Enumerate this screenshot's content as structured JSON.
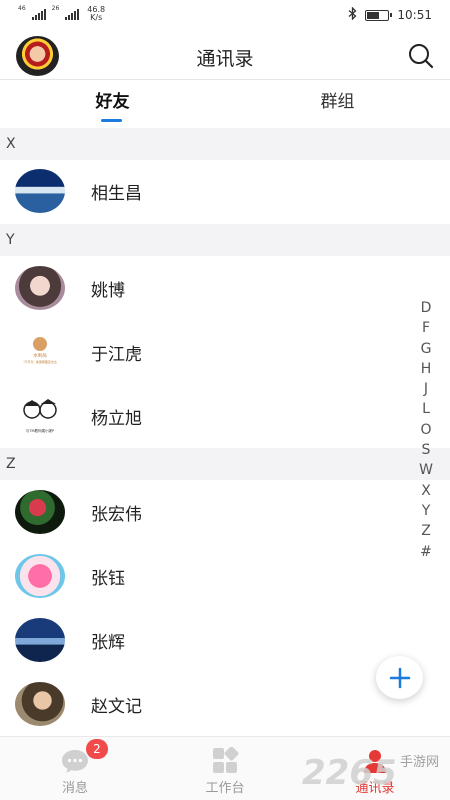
{
  "status_bar": {
    "sim1_label": "46",
    "sim2_label": "26",
    "speed_value": "46.8",
    "speed_unit": "K/s",
    "time": "10:51"
  },
  "header": {
    "title": "通讯录",
    "search_icon": "search-icon"
  },
  "tabs": [
    {
      "label": "好友",
      "active": true
    },
    {
      "label": "群组",
      "active": false
    }
  ],
  "sections": [
    {
      "letter": "X",
      "contacts": [
        {
          "name": "相生昌"
        }
      ]
    },
    {
      "letter": "Y",
      "contacts": [
        {
          "name": "姚博"
        },
        {
          "name": "于江虎"
        },
        {
          "name": "杨立旭"
        }
      ]
    },
    {
      "letter": "Z",
      "contacts": [
        {
          "name": "张宏伟"
        },
        {
          "name": "张钰"
        },
        {
          "name": "张辉"
        },
        {
          "name": "赵文记"
        }
      ]
    }
  ],
  "avatar_texts": {
    "logo_line1": "水利局",
    "logo_line2": "\"不平凡\" 奥里斯图克杰达",
    "comic_caption": "与TM着你嫂小妮P"
  },
  "index_letters": [
    "D",
    "F",
    "G",
    "H",
    "J",
    "L",
    "O",
    "S",
    "W",
    "X",
    "Y",
    "Z",
    "#"
  ],
  "fab": {
    "icon": "plus-icon"
  },
  "bottom_nav": [
    {
      "label": "消息",
      "icon": "chat-icon",
      "badge": "2"
    },
    {
      "label": "工作台",
      "icon": "grid-icon"
    },
    {
      "label": "通讯录",
      "icon": "contacts-icon",
      "active": true
    }
  ],
  "watermark": {
    "number": "2265",
    "text": "手游网"
  },
  "colors": {
    "accent_blue": "#1a7be0",
    "active_red": "#e53935",
    "badge_red": "#f04a4a",
    "section_bg": "#f3f3f5"
  }
}
